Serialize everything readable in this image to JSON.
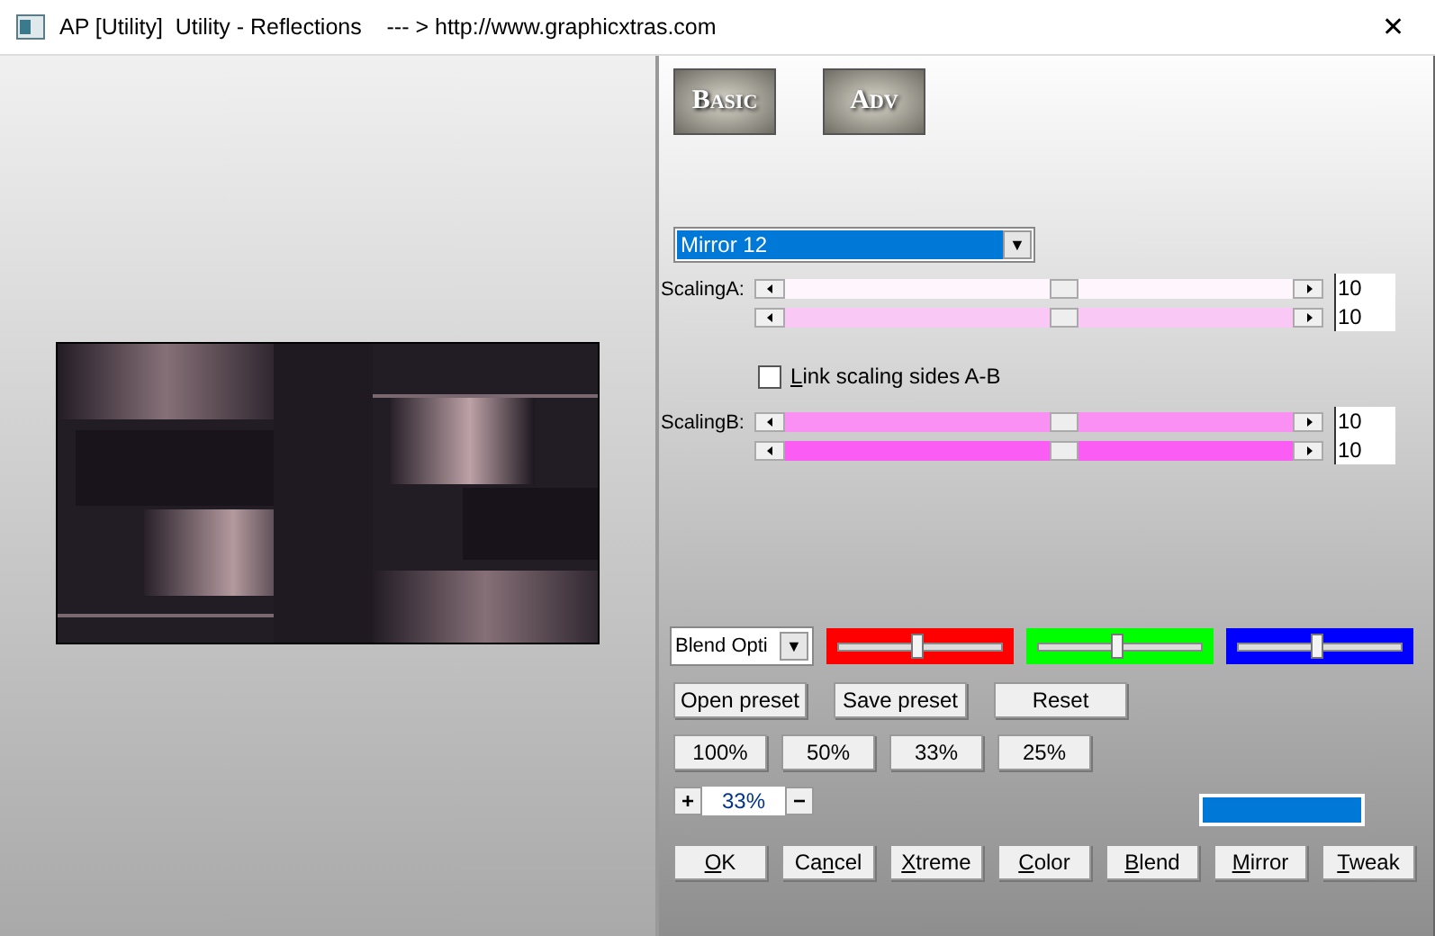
{
  "window": {
    "title": "AP [Utility]  Utility - Reflections    --- > http://www.graphicxtras.com",
    "close": "✕"
  },
  "mode_buttons": [
    "Basic",
    "Adv"
  ],
  "preset_dropdown": {
    "value": "Mirror 12",
    "arrow": "▼"
  },
  "scaling_a": {
    "label": "ScalingA:",
    "sliders": [
      {
        "level": 0.55,
        "value": "10",
        "color": "#fff6fd"
      },
      {
        "level": 0.55,
        "value": "10",
        "color": "#f9c8f5"
      }
    ]
  },
  "link_checkbox": {
    "label": {
      "key": "L",
      "after": "ink scaling sides A-B"
    },
    "checked": false
  },
  "scaling_b": {
    "label": "ScalingB:",
    "sliders": [
      {
        "level": 0.55,
        "value": "10",
        "color": "#fb90f4"
      },
      {
        "level": 0.55,
        "value": "10",
        "color": "#fa5cf4"
      }
    ]
  },
  "blend_dropdown": {
    "value": "Blend Opti",
    "arrow": "▼"
  },
  "color_sliders": [
    {
      "color": "#ff0000",
      "level": 0.5
    },
    {
      "color": "#00ff00",
      "level": 0.5
    },
    {
      "color": "#0000ff",
      "level": 0.5
    }
  ],
  "preset_buttons": [
    "Open preset",
    "Save preset",
    "Reset"
  ],
  "zoom_buttons": [
    "100%",
    "50%",
    "33%",
    "25%"
  ],
  "zoom": {
    "plus": "+",
    "value": "33%",
    "minus": "−"
  },
  "swatch": {
    "color": "#0078d7"
  },
  "action_buttons": [
    {
      "key": "O",
      "after": "K"
    },
    {
      "before": "Ca",
      "key": "n",
      "after": "cel"
    },
    {
      "key": "X",
      "after": "treme"
    },
    {
      "key": "C",
      "after": "olor"
    },
    {
      "key": "B",
      "after": "lend"
    },
    {
      "key": "M",
      "after": "irror"
    },
    {
      "key": "T",
      "after": "weak"
    }
  ]
}
